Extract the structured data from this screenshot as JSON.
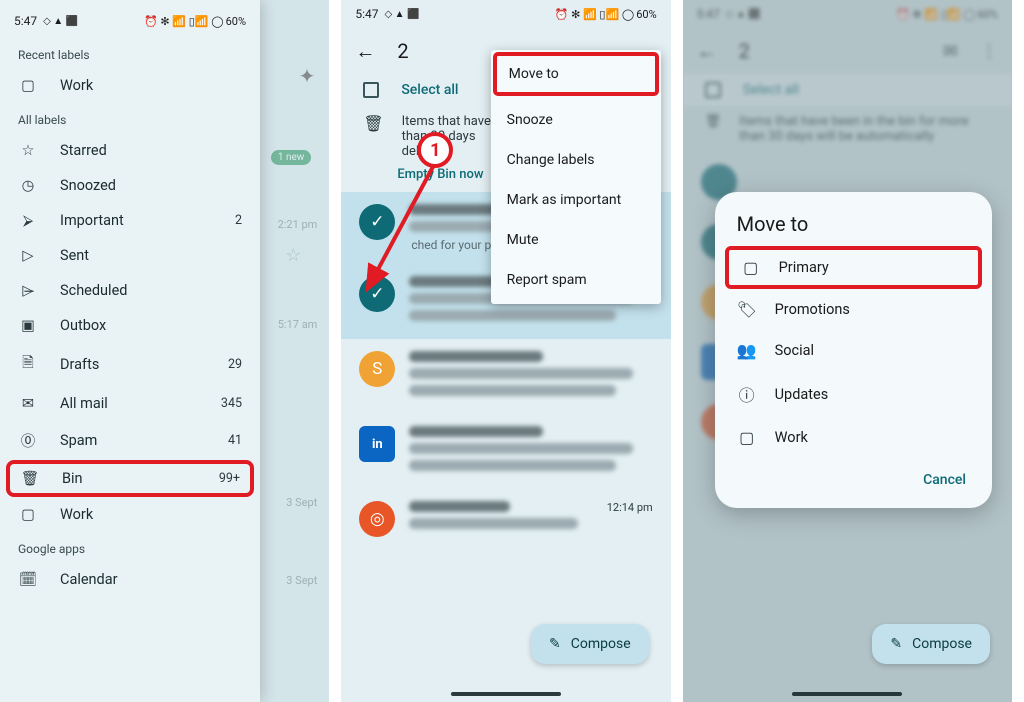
{
  "status": {
    "time": "5:47",
    "battery": "60%",
    "icons": "◑ ✦ ⬛",
    "right": "⏰ ✻ ⚡ 📶 ▯ ◯"
  },
  "s1": {
    "section_recent": "Recent labels",
    "section_all": "All labels",
    "section_google": "Google apps",
    "items": {
      "work": "Work",
      "starred": "Starred",
      "snoozed": "Snoozed",
      "important": "Important",
      "sent": "Sent",
      "scheduled": "Scheduled",
      "outbox": "Outbox",
      "drafts": "Drafts",
      "allmail": "All mail",
      "spam": "Spam",
      "bin": "Bin",
      "work2": "Work",
      "calendar": "Calendar"
    },
    "counts": {
      "important": "2",
      "drafts": "29",
      "allmail": "345",
      "spam": "41",
      "bin": "99+"
    },
    "chip": "1 new",
    "bd_times": {
      "t1": "2:21 pm",
      "t2": "5:17 am",
      "t3": "3 Sept",
      "t4": "3 Sept"
    }
  },
  "s2": {
    "count": "2",
    "select_all": "Select all",
    "notice": "Items that have been in the bin for more than 30 days will be automatically deleted.",
    "notice_short": "Items that have\nthan 30 days\ndeleted.",
    "empty": "Empty Bin now",
    "menu": [
      "Move to",
      "Snooze",
      "Change labels",
      "Mark as important",
      "Mute",
      "Report spam"
    ],
    "profile_mark": "ched for your profile   …",
    "time5": "12:14 pm",
    "compose": "Compose",
    "step": "1"
  },
  "s3": {
    "count": "2",
    "select_all": "Select all",
    "notice": "Items that have been in the bin for more than 30 days will be automatically",
    "dialog_title": "Move to",
    "options": {
      "primary": "Primary",
      "promotions": "Promotions",
      "social": "Social",
      "updates": "Updates",
      "work": "Work"
    },
    "cancel": "Cancel",
    "compose": "Compose"
  }
}
